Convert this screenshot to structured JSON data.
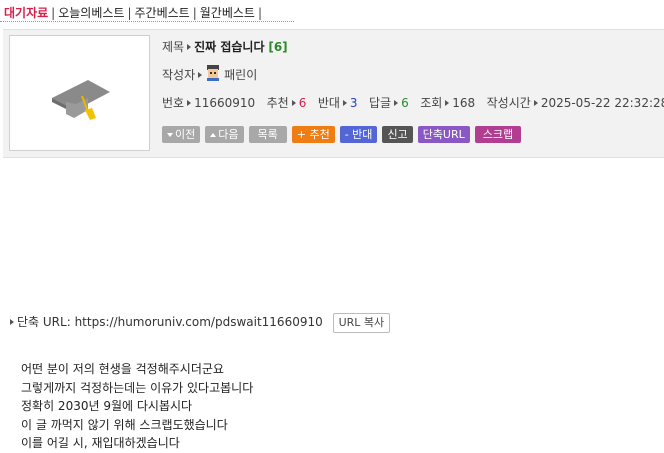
{
  "tabs": [
    {
      "label": "대기자료",
      "active": true
    },
    {
      "label": "오늘의베스트",
      "active": false
    },
    {
      "label": "주간베스트",
      "active": false
    },
    {
      "label": "월간베스트",
      "active": false
    }
  ],
  "post": {
    "title_label": "제목",
    "title": "진짜 접습니다",
    "comment_count": "[6]",
    "author_label": "작성자",
    "author": "패린이",
    "number_label": "번호",
    "number": "11660910",
    "recommend_label": "추천",
    "recommend": "6",
    "oppose_label": "반대",
    "oppose": "3",
    "reply_label": "답글",
    "reply": "6",
    "views_label": "조회",
    "views": "168",
    "time_label": "작성시간",
    "time": "2025-05-22 22:32:28"
  },
  "buttons": {
    "prev": "이전",
    "next": "다음",
    "list": "목록",
    "recommend": "+ 추천",
    "oppose": "- 반대",
    "report": "신고",
    "short_url": "단축URL",
    "scrap": "스크랩"
  },
  "short_url": {
    "label": "단축 URL:",
    "url": "https://humoruniv.com/pdswait11660910",
    "copy_label": "URL 복사"
  },
  "content": {
    "lines": [
      "어떤 분이 저의 현생을 걱정해주시더군요",
      "그렇게까지 걱정하는데는 이유가 있다고봅니다",
      "정확히 2030년 9월에 다시봅시다",
      "이 글 까먹지 않기 위해 스크랩도했습니다",
      "이를 어길 시, 재입대하겠습니다"
    ]
  },
  "colors": {
    "active_tab": "#d6204b",
    "recommend_btn": "#ef7d13",
    "oppose_btn": "#5466d6",
    "short_url_btn": "#8a58c4",
    "scrap_btn": "#b23e92"
  }
}
